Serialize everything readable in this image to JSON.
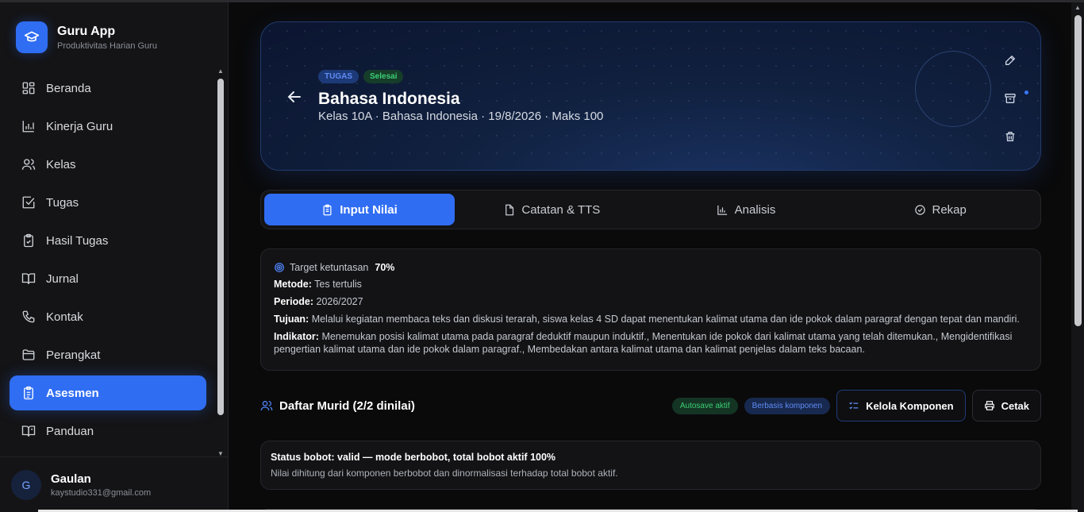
{
  "brand": {
    "title": "Guru App",
    "subtitle": "Produktivitas Harian Guru"
  },
  "sidebar": {
    "items": [
      {
        "label": "Beranda",
        "icon": "grid-icon",
        "active": false
      },
      {
        "label": "Kinerja Guru",
        "icon": "bar-chart-icon",
        "active": false
      },
      {
        "label": "Kelas",
        "icon": "users-icon",
        "active": false
      },
      {
        "label": "Tugas",
        "icon": "checkbox-icon",
        "active": false
      },
      {
        "label": "Hasil Tugas",
        "icon": "clipboard-check-icon",
        "active": false
      },
      {
        "label": "Jurnal",
        "icon": "book-open-icon",
        "active": false
      },
      {
        "label": "Kontak",
        "icon": "phone-icon",
        "active": false
      },
      {
        "label": "Perangkat",
        "icon": "folder-icon",
        "active": false
      },
      {
        "label": "Asesmen",
        "icon": "clipboard-list-icon",
        "active": true
      },
      {
        "label": "Panduan",
        "icon": "book-help-icon",
        "active": false
      }
    ]
  },
  "user": {
    "initial": "G",
    "name": "Gaulan",
    "email": "kaystudio331@gmail.com"
  },
  "hero": {
    "badges": [
      "TUGAS",
      "Selesai"
    ],
    "title": "Bahasa Indonesia",
    "subtitle": "Kelas 10A · Bahasa Indonesia · 19/8/2026 · Maks 100"
  },
  "tabs": [
    {
      "label": "Input Nilai",
      "icon": "clipboard-icon",
      "active": true
    },
    {
      "label": "Catatan & TTS",
      "icon": "file-icon",
      "active": false
    },
    {
      "label": "Analisis",
      "icon": "bar-chart-icon",
      "active": false
    },
    {
      "label": "Rekap",
      "icon": "check-circle-icon",
      "active": false
    }
  ],
  "info": {
    "target_label": "Target ketuntasan",
    "target_value": "70%",
    "metode_label": "Metode:",
    "metode_value": "Tes tertulis",
    "periode_label": "Periode:",
    "periode_value": "2026/2027",
    "tujuan_label": "Tujuan:",
    "tujuan_value": "Melalui kegiatan membaca teks dan diskusi terarah, siswa kelas 4 SD dapat menentukan kalimat utama dan ide pokok dalam paragraf dengan tepat dan mandiri.",
    "indikator_label": "Indikator:",
    "indikator_value": "Menemukan posisi kalimat utama pada paragraf deduktif maupun induktif., Menentukan ide pokok dari kalimat utama yang telah ditemukan., Mengidentifikasi pengertian kalimat utama dan ide pokok dalam paragraf., Membedakan antara kalimat utama dan kalimat penjelas dalam teks bacaan."
  },
  "students": {
    "title": "Daftar Murid (2/2 dinilai)",
    "autosave": "Autosave aktif",
    "mode": "Berbasis komponen",
    "manage_label": "Kelola Komponen",
    "print_label": "Cetak"
  },
  "status": {
    "line1": "Status bobot: valid — mode berbobot, total bobot aktif 100%",
    "line2": "Nilai dihitung dari komponen berbobot dan dinormalisasi terhadap total bobot aktif."
  },
  "colors": {
    "accent": "#2f6df3",
    "success": "#3ccf75",
    "background": "#0a0a0b"
  }
}
